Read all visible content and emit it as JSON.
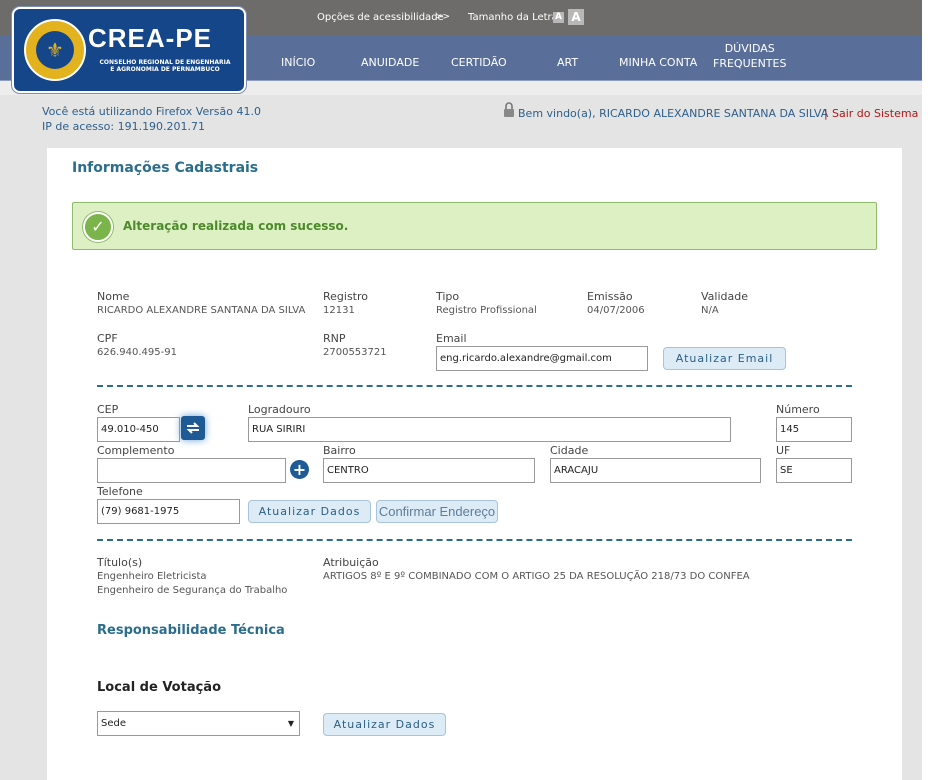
{
  "header": {
    "accessibility_label": "Opções de acessibilidade",
    "accessibility_arrows": ">>",
    "font_size_label": "Tamanho da Letra",
    "font_small": "A",
    "font_large": "A"
  },
  "logo": {
    "title": "CREA-PE",
    "subtitle_line1": "CONSELHO REGIONAL DE ENGENHARIA",
    "subtitle_line2": "E AGRONOMIA DE PERNAMBUCO"
  },
  "nav": {
    "items": [
      "INÍCIO",
      "ANUIDADE",
      "CERTIDÃO",
      "ART",
      "MINHA CONTA"
    ],
    "faq_line1": "DÚVIDAS",
    "faq_line2": "FREQUENTES",
    "active": "MINHA CONTA"
  },
  "session": {
    "browser_text": "Você está utilizando Firefox Versão 41.0",
    "ip_text": "IP de acesso: 191.190.201.71",
    "welcome": "Bem vindo(a), RICARDO ALEXANDRE SANTANA DA SILVA",
    "separator": "|",
    "logout": "Sair do Sistema"
  },
  "page": {
    "title": "Informações Cadastrais",
    "success_message": "Alteração realizada com sucesso."
  },
  "profile": {
    "name_label": "Nome",
    "name": "RICARDO ALEXANDRE SANTANA DA SILVA",
    "registro_label": "Registro",
    "registro": "12131",
    "tipo_label": "Tipo",
    "tipo": "Registro Profissional",
    "emissao_label": "Emissão",
    "emissao": "04/07/2006",
    "validade_label": "Validade",
    "validade": "N/A",
    "cpf_label": "CPF",
    "cpf": "626.940.495-91",
    "rnp_label": "RNP",
    "rnp": "2700553721",
    "email_label": "Email",
    "email": "eng.ricardo.alexandre@gmail.com",
    "update_email_button": "Atualizar Email"
  },
  "address": {
    "cep_label": "CEP",
    "cep": "49.010-450",
    "logradouro_label": "Logradouro",
    "logradouro": "RUA SIRIRI",
    "numero_label": "Número",
    "numero": "145",
    "complemento_label": "Complemento",
    "complemento": "",
    "bairro_label": "Bairro",
    "bairro": "CENTRO",
    "cidade_label": "Cidade",
    "cidade": "ARACAJU",
    "uf_label": "UF",
    "uf": "SE",
    "telefone_label": "Telefone",
    "telefone": "(79) 9681-1975",
    "update_button": "Atualizar Dados",
    "confirm_button": "Confirmar Endereço"
  },
  "titles": {
    "titulos_label": "Título(s)",
    "titulos": [
      "Engenheiro Eletricista",
      "Engenheiro de Segurança do Trabalho"
    ],
    "atribuicao_label": "Atribuição",
    "atribuicao": "ARTIGOS 8º E 9º COMBINADO COM O ARTIGO 25 DA RESOLUÇÃO 218/73 DO CONFEA"
  },
  "responsabilidade": {
    "title": "Responsabilidade Técnica"
  },
  "votacao": {
    "title": "Local de Votação",
    "selected": "Sede",
    "update_button": "Atualizar Dados"
  },
  "colors": {
    "nav_bg": "#5a6e9a",
    "top_bg": "#6e6c6b",
    "accent": "#e1c35e",
    "title_blue": "#2b6d8c",
    "success_green": "#4e8a2b",
    "logout_red": "#b01818"
  }
}
